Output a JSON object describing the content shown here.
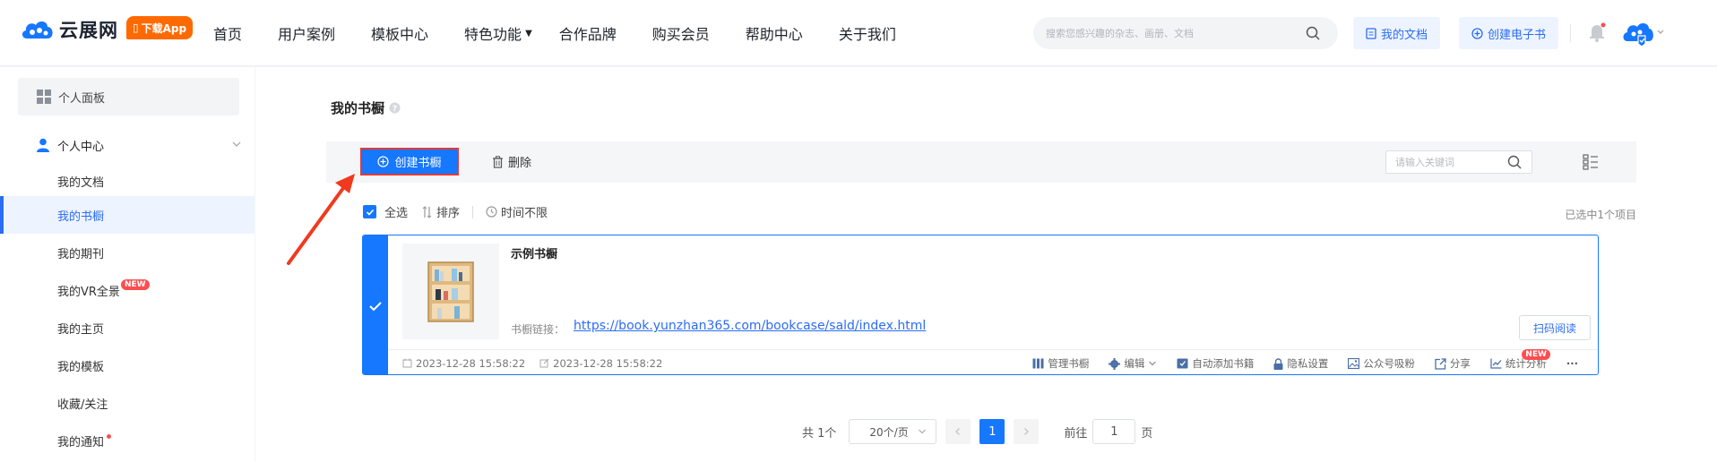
{
  "header": {
    "brand": "云展网",
    "app_button": "下载App",
    "nav": [
      "首页",
      "用户案例",
      "模板中心",
      "特色功能",
      "合作品牌",
      "购买会员",
      "帮助中心",
      "关于我们"
    ],
    "search_placeholder": "搜索您感兴趣的杂志、画册、文档",
    "my_docs": "我的文档",
    "create_ebook": "创建电子书"
  },
  "sidebar": {
    "panel": "个人面板",
    "center": "个人中心",
    "items": [
      {
        "label": "我的文档"
      },
      {
        "label": "我的书橱"
      },
      {
        "label": "我的期刊"
      },
      {
        "label": "我的VR全景",
        "badge": "NEW"
      },
      {
        "label": "我的主页"
      },
      {
        "label": "我的模板"
      },
      {
        "label": "收藏/关注"
      },
      {
        "label": "我的通知"
      }
    ]
  },
  "main": {
    "title": "我的书橱",
    "create_button": "创建书橱",
    "delete_button": "删除",
    "keyword_placeholder": "请输入关键词",
    "select_all": "全选",
    "sort": "排序",
    "time_filter": "时间不限",
    "selected_count": "已选中1个项目",
    "card": {
      "name": "示例书橱",
      "link_label": "书橱链接：",
      "link": "https://book.yunzhan365.com/bookcase/sald/index.html",
      "scan_button": "扫码阅读",
      "created": "2023-12-28 15:58:22",
      "modified": "2023-12-28 15:58:22",
      "actions": {
        "manage": "管理书橱",
        "edit": "编辑",
        "auto_add": "自动添加书籍",
        "privacy": "隐私设置",
        "wechat": "公众号吸粉",
        "share": "分享",
        "stats": "统计分析",
        "stats_badge": "NEW",
        "more": "···"
      }
    },
    "pager": {
      "total": "共 1个",
      "page_size": "20个/页",
      "current": "1",
      "goto_label": "前往",
      "goto_value": "1",
      "page_unit": "页"
    }
  },
  "colors": {
    "primary": "#1677ff",
    "orange": "#ff6a00",
    "red": "#e53935"
  }
}
